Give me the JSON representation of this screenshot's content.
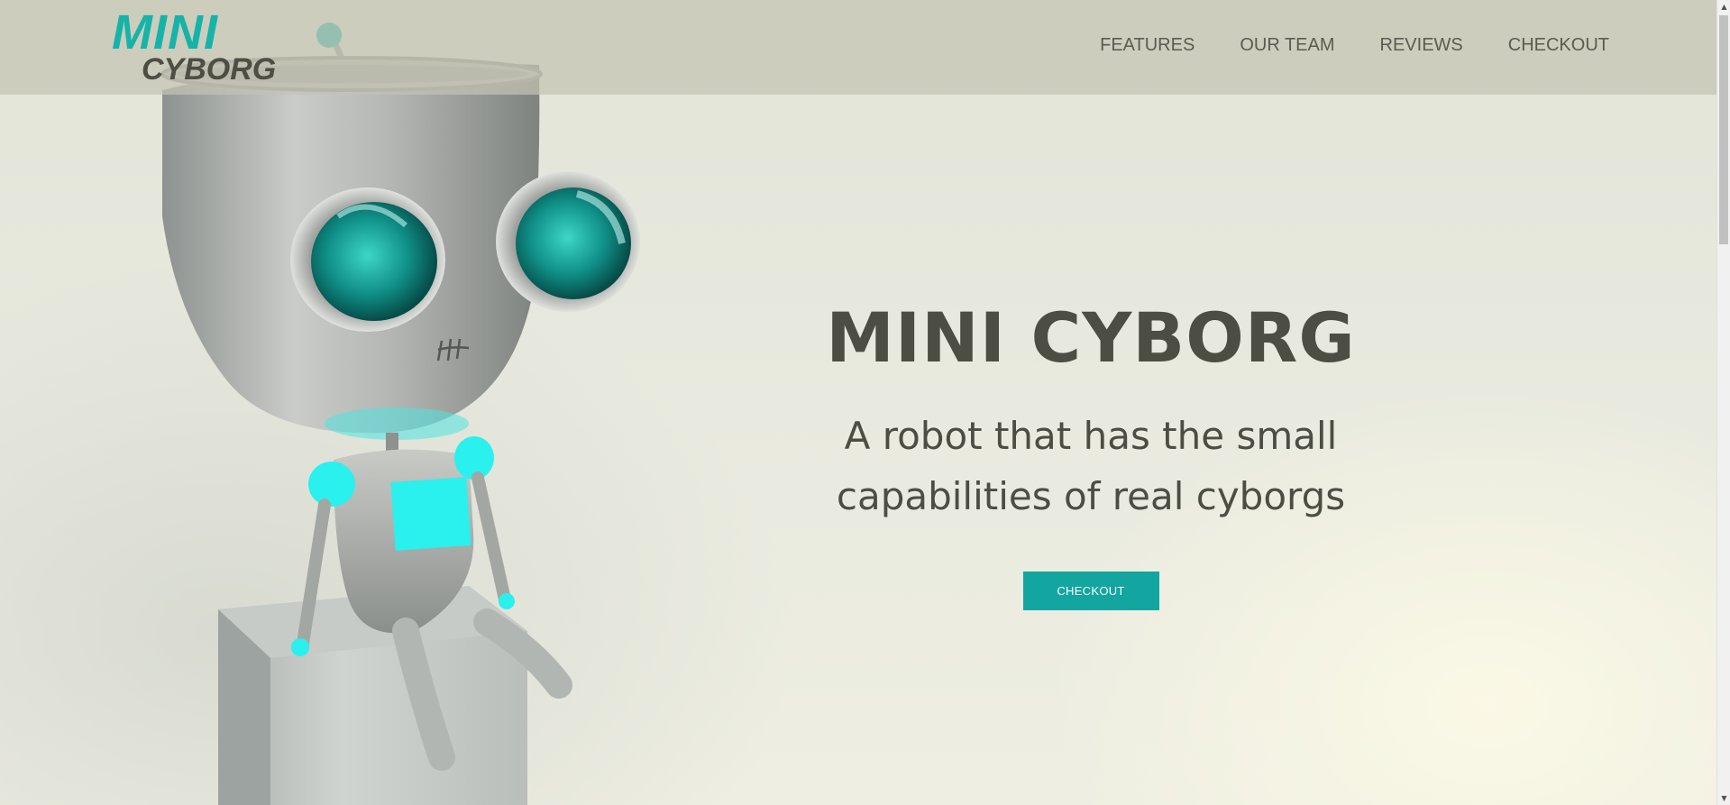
{
  "brand": {
    "logo_line1": "MINI",
    "logo_line2": "CYBORG",
    "accent_color": "#16b3a8"
  },
  "nav": {
    "items": [
      {
        "label": "FEATURES"
      },
      {
        "label": "OUR TEAM"
      },
      {
        "label": "REVIEWS"
      },
      {
        "label": "CHECKOUT"
      }
    ]
  },
  "hero": {
    "title": "MINI CYBORG",
    "subtitle_line1": "A robot that has the small",
    "subtitle_line2": "capabilities of real cyborgs",
    "cta_label": "CHECKOUT",
    "cta_color": "#13a6a0",
    "image": "robot-illustration"
  },
  "scrollbar": {
    "up_icon": "arrow-up-icon",
    "down_icon": "arrow-down-icon"
  }
}
